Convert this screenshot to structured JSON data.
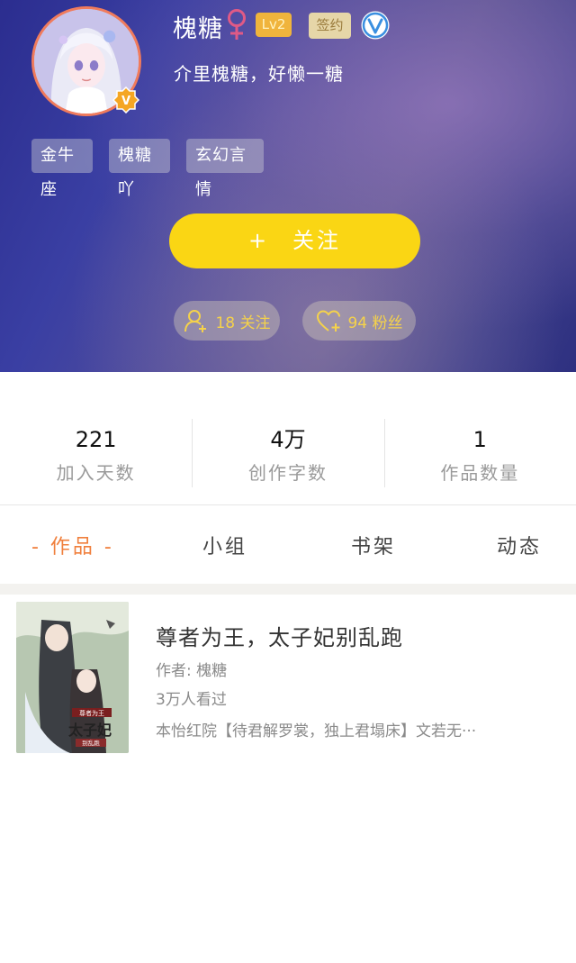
{
  "profile": {
    "username": "槐糖",
    "gender_icon": "female-symbol",
    "level": "Lv2",
    "sign_badge": "签约",
    "verified_icon": "verified-v",
    "bio": "介里槐糖，好懒一糖",
    "tags": [
      "金牛座",
      "槐糖吖",
      "玄幻言情"
    ]
  },
  "follow_button": {
    "plus": "+",
    "label": "关注"
  },
  "social": {
    "following": "18 关注",
    "fans": "94 粉丝"
  },
  "stats": [
    {
      "value": "221",
      "label": "加入天数"
    },
    {
      "value": "4万",
      "label": "创作字数"
    },
    {
      "value": "1",
      "label": "作品数量"
    }
  ],
  "tabs": [
    {
      "label": "- 作品 -",
      "active": true
    },
    {
      "label": "小组",
      "active": false
    },
    {
      "label": "书架",
      "active": false
    },
    {
      "label": "动态",
      "active": false
    }
  ],
  "works": [
    {
      "title": "尊者为王，太子妃别乱跑",
      "author": "作者: 槐糖",
      "views": "3万人看过",
      "description": "本怡红院【待君解罗裳，独上君塌床】文若无···"
    }
  ],
  "colors": {
    "follow_button": "#fad614",
    "active_tab": "#f07f3c",
    "pill_text": "#f5d24a",
    "level_badge": "#f0b43c"
  }
}
